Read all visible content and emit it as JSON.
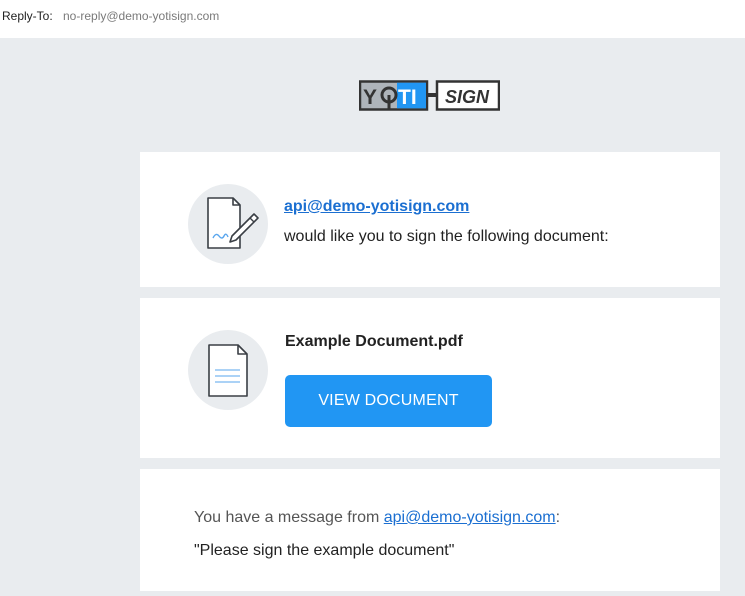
{
  "header": {
    "reply_to_label": "Reply-To:",
    "reply_to_value": "no-reply@demo-yotisign.com"
  },
  "logo": {
    "part1": "YOTI",
    "part2": "SIGN",
    "accent_color": "#2196f3",
    "icon": "yoti-sign-logo"
  },
  "request_card": {
    "sender_email": "api@demo-yotisign.com",
    "request_text": "would like you to sign the following document:",
    "icon": "signature-document-icon"
  },
  "document_card": {
    "document_name": "Example Document.pdf",
    "view_button_label": "VIEW DOCUMENT",
    "button_color": "#2196f3",
    "icon": "document-icon"
  },
  "message_card": {
    "message_prefix": "You have a message from ",
    "message_sender": "api@demo-yotisign.com",
    "message_suffix": ":",
    "message_text": "\"Please sign the example document\""
  }
}
